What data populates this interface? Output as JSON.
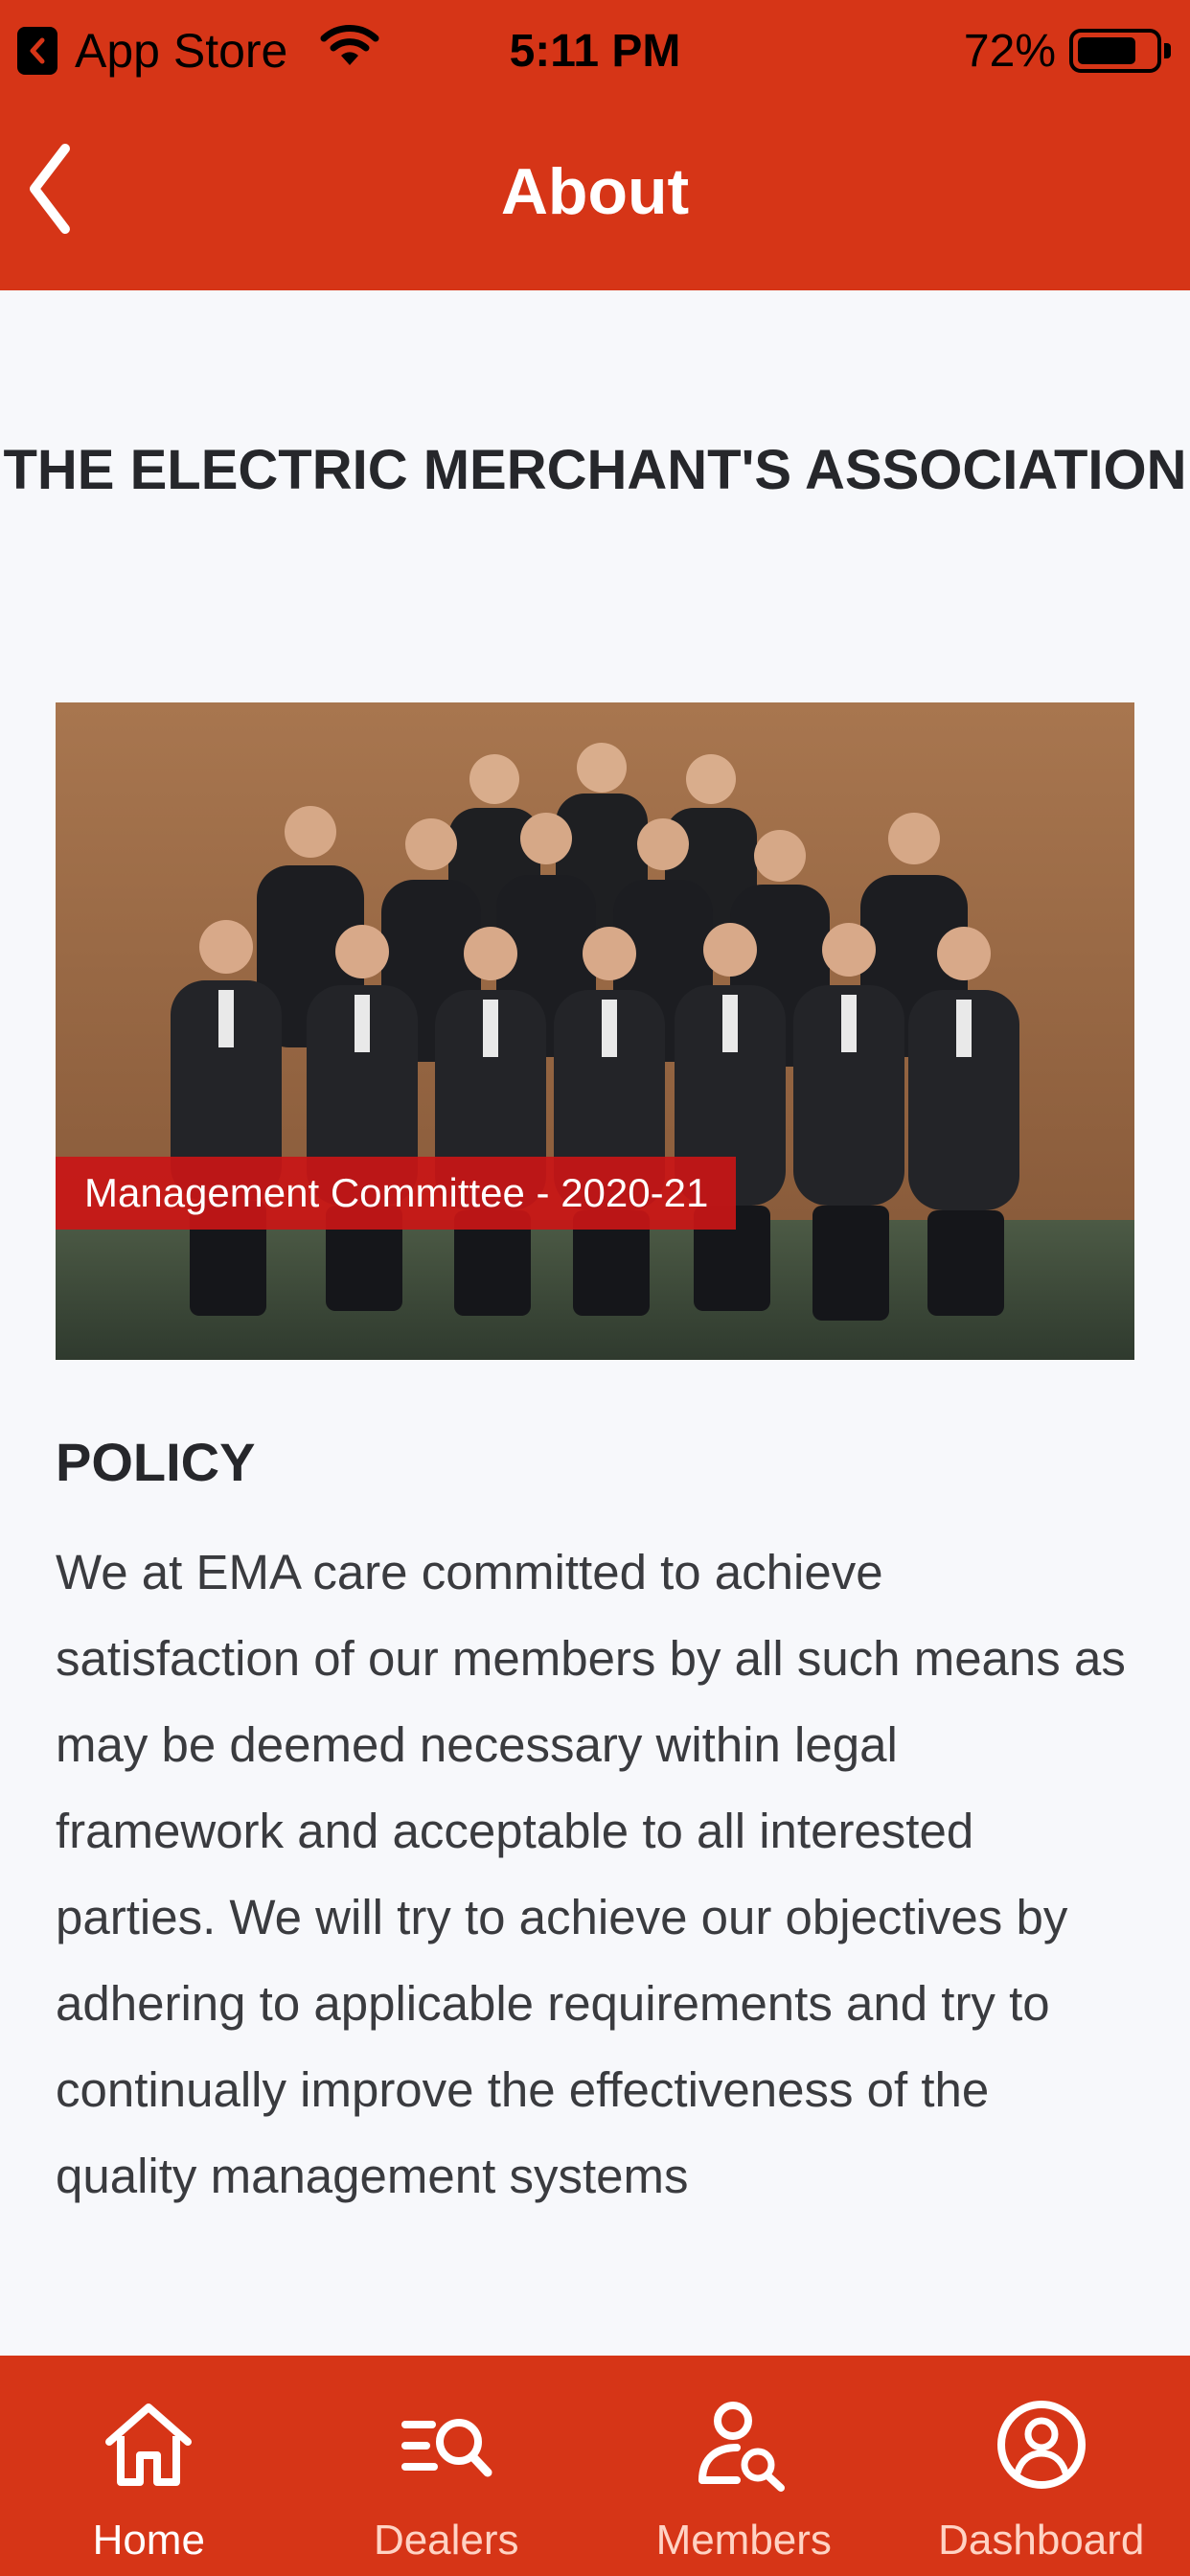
{
  "status_bar": {
    "carrier": "App Store",
    "time": "5:11 PM",
    "battery": "72%"
  },
  "nav": {
    "title": "About",
    "back_icon": "chevron-left-icon"
  },
  "content": {
    "org_title": "THE ELECTRIC MERCHANT'S ASSOCIATION",
    "photo_caption": "Management Committee - 2020-21",
    "policy_heading": "POLICY",
    "policy_text": "We at EMA care committed to achieve satisfaction of our members by all such means as may be deemed necessary within legal framework and acceptable to all interested parties. We will try to achieve our objectives by adhering to applicable requirements and try to continually improve the effectiveness of the quality management systems"
  },
  "tabs": [
    {
      "label": "Home",
      "icon": "home-icon",
      "active": true
    },
    {
      "label": "Dealers",
      "icon": "dealer-search-icon",
      "active": false
    },
    {
      "label": "Members",
      "icon": "member-search-icon",
      "active": false
    },
    {
      "label": "Dashboard",
      "icon": "user-circle-icon",
      "active": false
    }
  ],
  "colors": {
    "brand": "#d63517",
    "background": "#f7f8fb",
    "caption_bg": "#c91616",
    "text_dark": "#26272b"
  }
}
